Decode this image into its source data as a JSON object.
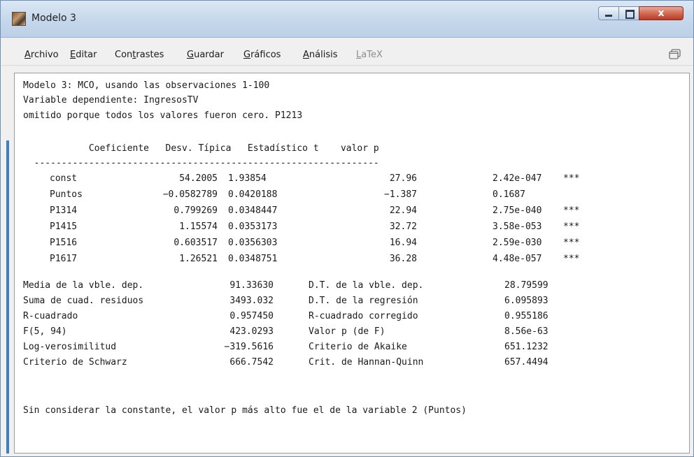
{
  "window": {
    "title": "Modelo 3",
    "close_glyph": "x"
  },
  "menu": {
    "items": [
      {
        "id": "archivo",
        "pre": "",
        "mnemonic": "A",
        "post": "rchivo",
        "enabled": true
      },
      {
        "id": "editar",
        "pre": "",
        "mnemonic": "E",
        "post": "ditar",
        "enabled": true
      },
      {
        "id": "contrastes",
        "pre": "Con",
        "mnemonic": "t",
        "post": "rastes",
        "enabled": true
      },
      {
        "id": "guardar",
        "pre": "",
        "mnemonic": "G",
        "post": "uardar",
        "enabled": true
      },
      {
        "id": "graficos",
        "pre": "",
        "mnemonic": "G",
        "post": "ráficos",
        "enabled": true
      },
      {
        "id": "analisis",
        "pre": "",
        "mnemonic": "A",
        "post": "nálisis",
        "enabled": true
      },
      {
        "id": "latex",
        "pre": "",
        "mnemonic": "L",
        "post": "aTeX",
        "enabled": false
      }
    ]
  },
  "output": {
    "header_lines": [
      "Modelo 3: MCO, usando las observaciones 1-100",
      "Variable dependiente: IngresosTV",
      "omitido porque todos los valores fueron cero. P1213"
    ],
    "table_header": "            Coeficiente   Desv. Típica   Estadístico t    valor p",
    "table_rule": "  ---------------------------------------------------------------",
    "rows": [
      {
        "name": "const",
        "coef": "54.2005",
        "se": "1.93854",
        "t": "27.96",
        "p": "2.42e-047",
        "stars": "***"
      },
      {
        "name": "Puntos",
        "coef": "−0.0582789",
        "se": "0.0420188",
        "t": "−1.387",
        "p": "0.1687",
        "stars": ""
      },
      {
        "name": "P1314",
        "coef": "0.799269",
        "se": "0.0348447",
        "t": "22.94",
        "p": "2.75e-040",
        "stars": "***"
      },
      {
        "name": "P1415",
        "coef": "1.15574",
        "se": "0.0353173",
        "t": "32.72",
        "p": "3.58e-053",
        "stars": "***"
      },
      {
        "name": "P1516",
        "coef": "0.603517",
        "se": "0.0356303",
        "t": "16.94",
        "p": "2.59e-030",
        "stars": "***"
      },
      {
        "name": "P1617",
        "coef": "1.26521",
        "se": "0.0348751",
        "t": "36.28",
        "p": "4.48e-057",
        "stars": "***"
      }
    ],
    "stats": [
      {
        "l1": "Media de la vble. dep.",
        "v1": "91.33630",
        "l2": "D.T. de la vble. dep.",
        "v2": "28.79599"
      },
      {
        "l1": "Suma de cuad. residuos",
        "v1": "3493.032",
        "l2": "D.T. de la regresión",
        "v2": "6.095893"
      },
      {
        "l1": "R-cuadrado",
        "v1": "0.957450",
        "l2": "R-cuadrado corregido",
        "v2": "0.955186"
      },
      {
        "l1": "F(5, 94)",
        "v1": "423.0293",
        "l2": "Valor p (de F)",
        "v2": "8.56e-63"
      },
      {
        "l1": "Log-verosimilitud",
        "v1": "−319.5616",
        "l2": "Criterio de Akaike",
        "v2": "651.1232"
      },
      {
        "l1": "Criterio de Schwarz",
        "v1": "666.7542",
        "l2": "Crit. de Hannan-Quinn",
        "v2": "657.4494"
      }
    ],
    "footer": "Sin considerar la constante, el valor p más alto fue el de la variable 2 (Puntos)"
  }
}
